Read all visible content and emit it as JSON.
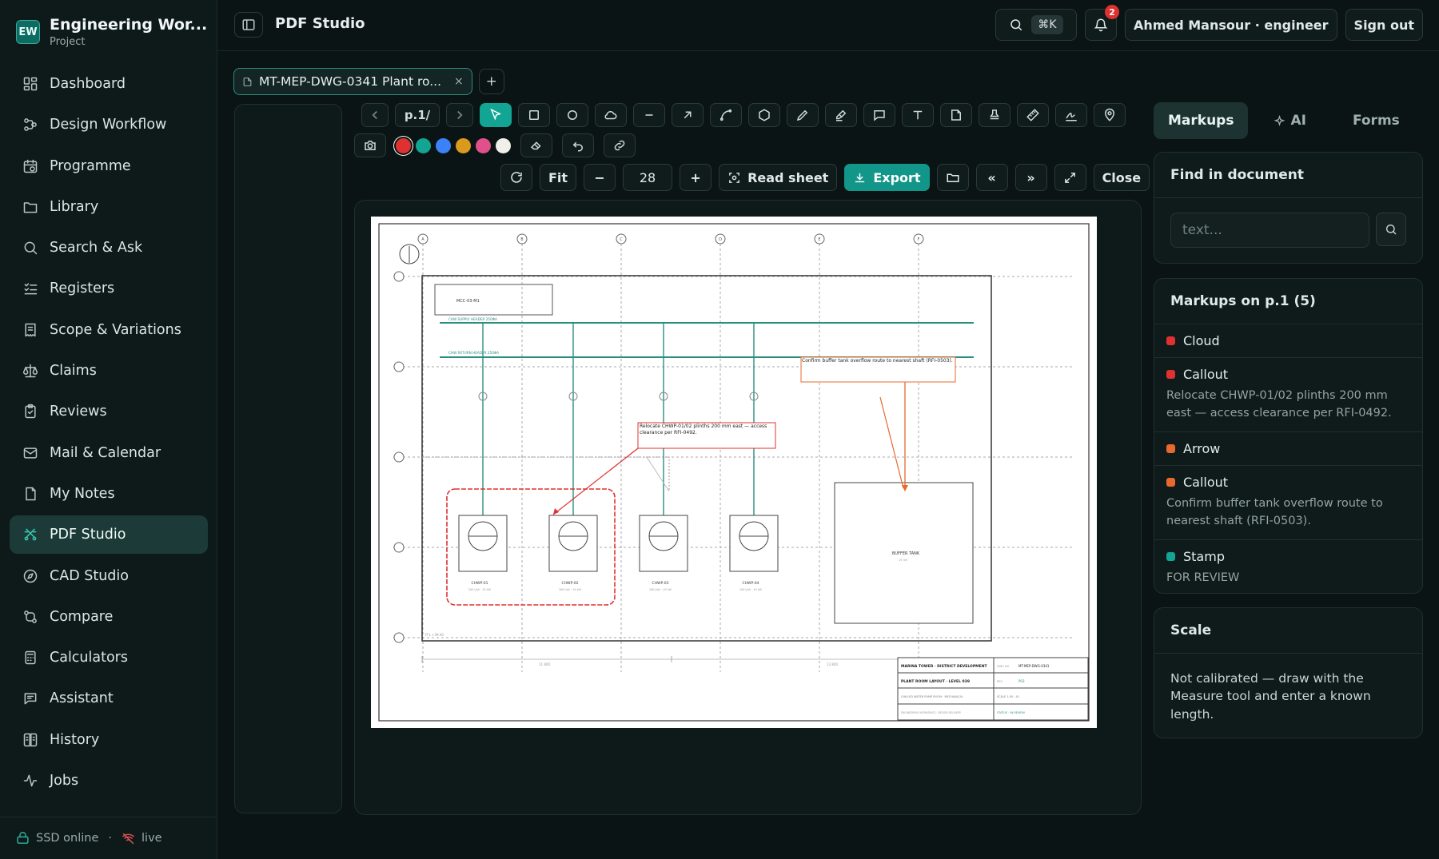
{
  "workspace": {
    "logo": "EW",
    "name": "Engineering Wor...",
    "subtitle": "Project"
  },
  "nav": [
    {
      "label": "Dashboard",
      "icon": "dashboard-icon",
      "active": false
    },
    {
      "label": "Design Workflow",
      "icon": "workflow-icon",
      "active": false
    },
    {
      "label": "Programme",
      "icon": "calendar-clock-icon",
      "active": false
    },
    {
      "label": "Library",
      "icon": "folder-icon",
      "active": false
    },
    {
      "label": "Search & Ask",
      "icon": "search-icon",
      "active": false
    },
    {
      "label": "Registers",
      "icon": "checklist-icon",
      "active": false
    },
    {
      "label": "Scope & Variations",
      "icon": "receipt-icon",
      "active": false
    },
    {
      "label": "Claims",
      "icon": "scale-icon",
      "active": false
    },
    {
      "label": "Reviews",
      "icon": "clipboard-check-icon",
      "active": false
    },
    {
      "label": "Mail & Calendar",
      "icon": "mail-icon",
      "active": false
    },
    {
      "label": "My Notes",
      "icon": "note-icon",
      "active": false
    },
    {
      "label": "PDF Studio",
      "icon": "pdf-studio-icon",
      "active": true
    },
    {
      "label": "CAD Studio",
      "icon": "compass-icon",
      "active": false
    },
    {
      "label": "Compare",
      "icon": "compare-icon",
      "active": false
    },
    {
      "label": "Calculators",
      "icon": "calculator-icon",
      "active": false
    },
    {
      "label": "Assistant",
      "icon": "chat-icon",
      "active": false
    },
    {
      "label": "History",
      "icon": "book-icon",
      "active": false
    },
    {
      "label": "Jobs",
      "icon": "activity-icon",
      "active": false
    }
  ],
  "footer": {
    "storage": "SSD online",
    "separator": "·",
    "live": "live"
  },
  "topbar": {
    "title": "PDF Studio",
    "shortcut": "⌘K",
    "notifications": "2",
    "user": "Ahmed Mansour · engineer",
    "signout": "Sign out"
  },
  "doc_tab": {
    "label": "MT-MEP-DWG-0341 Plant ro...",
    "close": "×",
    "add": "+"
  },
  "toolbar": {
    "page": "p.1/",
    "fit": "Fit",
    "zoom": "28",
    "minus": "−",
    "plus": "+",
    "read_sheet": "Read sheet",
    "export": "Export",
    "prev_all": "«",
    "next_all": "»",
    "close": "Close"
  },
  "colors": {
    "accent": "#12a594",
    "swatches": [
      "#e03131",
      "#12a594",
      "#3b82f6",
      "#d99a1e",
      "#e0508a",
      "#f0efe9"
    ]
  },
  "drawing": {
    "grid_top": [
      "A",
      "B",
      "C",
      "D",
      "E",
      "F"
    ],
    "header1": "MCC-03-M1",
    "supply": "CHW SUPPLY HEADER 250ΦA",
    "return": "CHW RETURN HEADER 250ΦA",
    "pumps": [
      "CHWP-01",
      "CHWP-02",
      "CHWP-03",
      "CHWP-04"
    ],
    "pump_spec": "200 l/s/h · 45 kW",
    "callout1": "Relocate CHWP-01/02 plinths 200 mm east — access clearance per RFI-0492.",
    "callout2": "Confirm buffer tank overflow route to nearest shaft (RFI-0503).",
    "tank": "BUFFER TANK",
    "tank_sub": "15 m3",
    "ffl": "FFL +39.00",
    "dim1": "11 800",
    "dim2": "13 800",
    "tb_project": "MARINA TOWER · DISTRICT DEVELOPMENT",
    "tb_dwgno_label": "DWG NO",
    "tb_dwgno": "MT-MEP-DWG-0341",
    "tb_title": "PLANT ROOM LAYOUT · LEVEL 039",
    "tb_rev_label": "REV",
    "tb_rev": "P03",
    "tb_sub": "CHILLED WATER PUMP ROOM · MECHANICAL",
    "tb_scale": "SCALE 1:50 · A1",
    "tb_company": "ENGINEERING WORKSPACE · DESIGN DELIVERY",
    "tb_status": "STATUS · IN REVIEW"
  },
  "right_panel": {
    "tabs": [
      {
        "label": "Markups",
        "active": true
      },
      {
        "label": "AI",
        "active": false
      },
      {
        "label": "Forms",
        "active": false
      }
    ],
    "find": {
      "title": "Find in document",
      "placeholder": "text..."
    },
    "markups": {
      "title": "Markups on p.1 (5)",
      "items": [
        {
          "type": "Cloud",
          "color": "#e03131",
          "desc": ""
        },
        {
          "type": "Callout",
          "color": "#e03131",
          "desc": "Relocate CHWP-01/02 plinths 200 mm east — access clearance per RFI-0492."
        },
        {
          "type": "Arrow",
          "color": "#e8692d",
          "desc": ""
        },
        {
          "type": "Callout",
          "color": "#e8692d",
          "desc": "Confirm buffer tank overflow route to nearest shaft (RFI-0503)."
        },
        {
          "type": "Stamp",
          "color": "#12a594",
          "desc": "FOR REVIEW"
        }
      ]
    },
    "scale": {
      "title": "Scale",
      "text": "Not calibrated — draw with the Measure tool and enter a known length."
    }
  }
}
